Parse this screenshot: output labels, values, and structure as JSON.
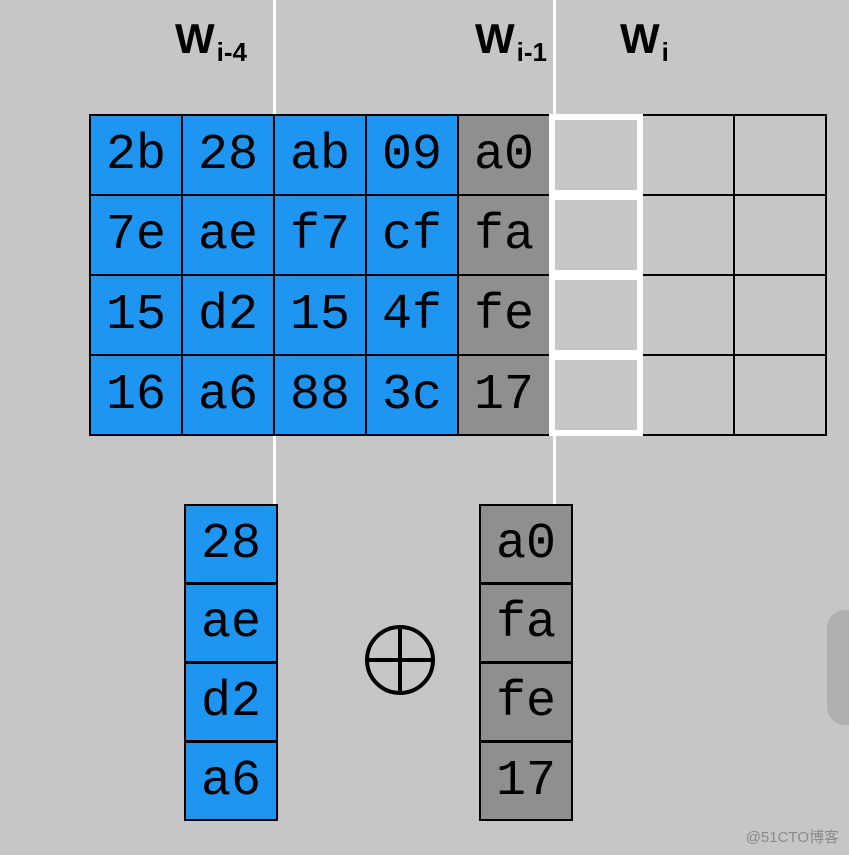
{
  "labels": {
    "w_i_minus_4": {
      "main": "W",
      "sub": "i-4"
    },
    "w_i_minus_1": {
      "main": "W",
      "sub": "i-1"
    },
    "w_i": {
      "main": "W",
      "sub": "i"
    }
  },
  "grid": {
    "blue": [
      [
        "2b",
        "28",
        "ab",
        "09"
      ],
      [
        "7e",
        "ae",
        "f7",
        "cf"
      ],
      [
        "15",
        "d2",
        "15",
        "4f"
      ],
      [
        "16",
        "a6",
        "88",
        "3c"
      ]
    ],
    "gray_col": [
      "a0",
      "fa",
      "fe",
      "17"
    ]
  },
  "left_operand": [
    "28",
    "ae",
    "d2",
    "a6"
  ],
  "right_operand": [
    "a0",
    "fa",
    "fe",
    "17"
  ],
  "watermark": "@51CTO博客"
}
